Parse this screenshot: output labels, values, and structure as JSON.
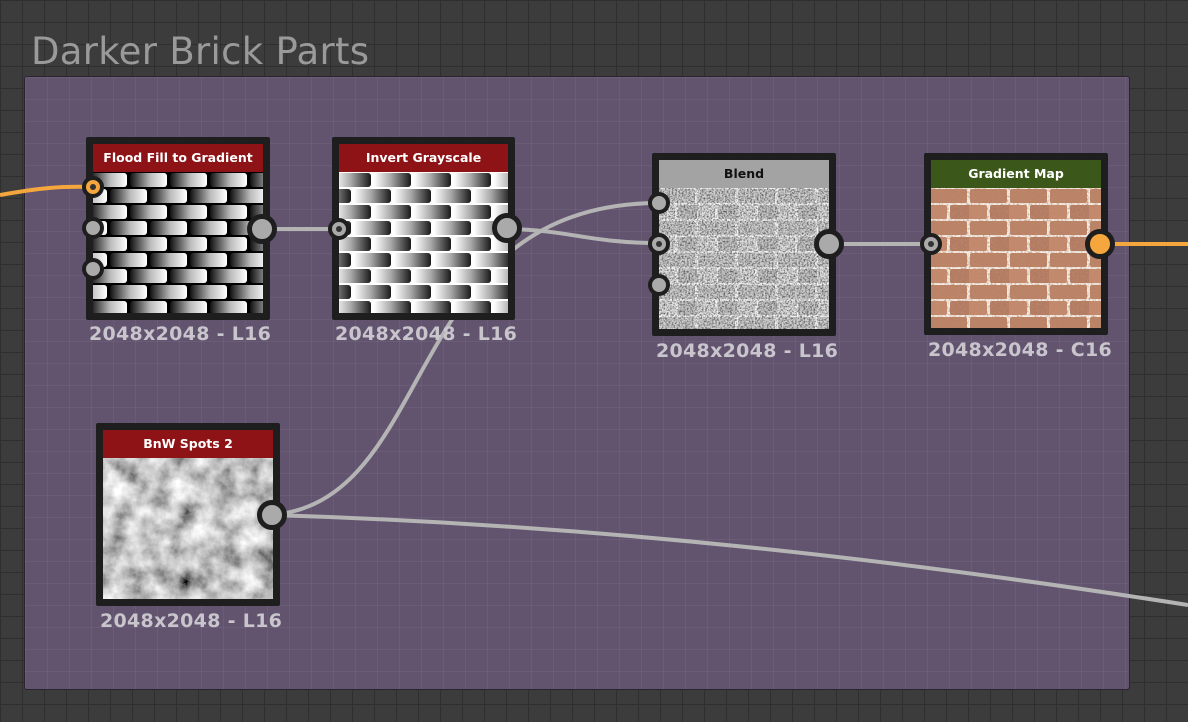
{
  "frame": {
    "title": "Darker Brick Parts"
  },
  "nodes": {
    "flood_fill": {
      "title": "Flood Fill to Gradient",
      "resolution": "2048x2048 - L16",
      "header_color": "#8e1316"
    },
    "invert": {
      "title": "Invert Grayscale",
      "resolution": "2048x2048 - L16",
      "header_color": "#8e1316"
    },
    "blend": {
      "title": "Blend",
      "resolution": "2048x2048 - L16",
      "header_color": "#a3a3a3"
    },
    "gradient_map": {
      "title": "Gradient Map",
      "resolution": "2048x2048 - C16",
      "header_color": "#3b5719"
    },
    "bnw_spots": {
      "title": "BnW Spots 2",
      "resolution": "2048x2048 - L16",
      "header_color": "#8e1316"
    }
  },
  "colors": {
    "wire": "#b4b4b4",
    "active_wire": "#f5a63c",
    "frame_background": "#62536f",
    "canvas_background": "#3c3c3c"
  }
}
